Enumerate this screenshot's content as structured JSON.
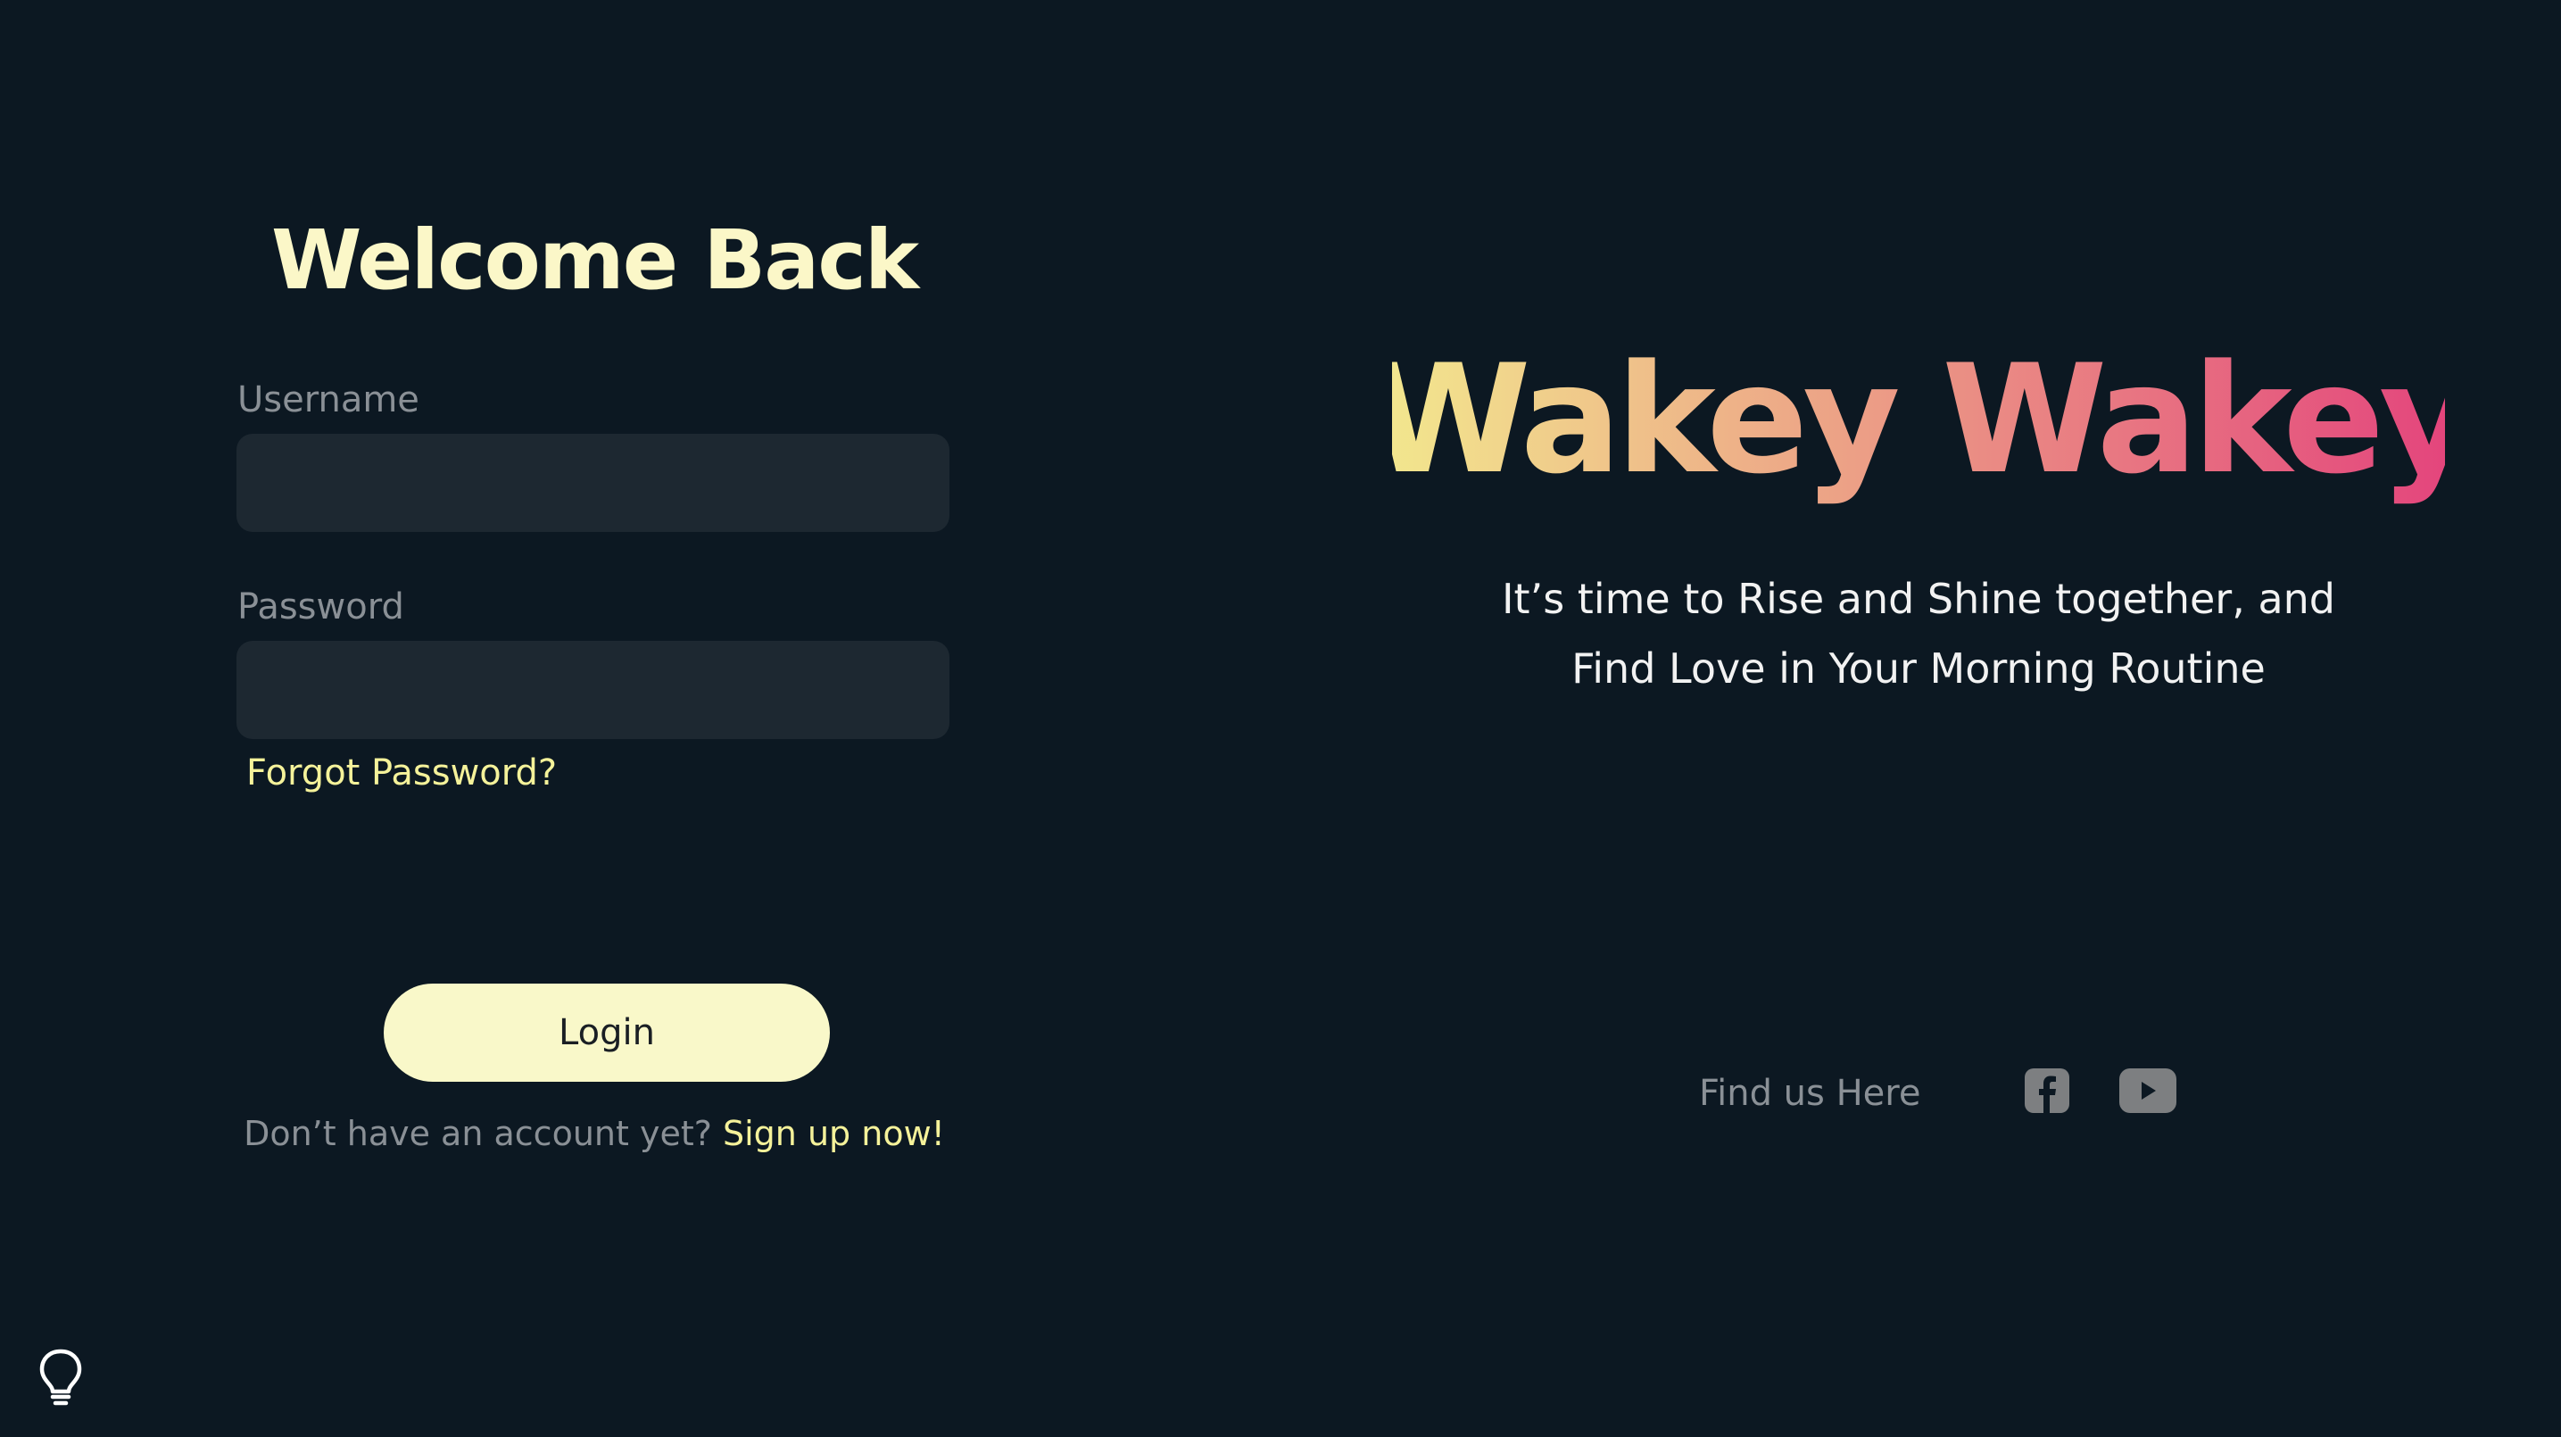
{
  "login": {
    "title": "Welcome Back",
    "username_label": "Username",
    "username_value": "",
    "password_label": "Password",
    "password_value": "",
    "forgot_password": "Forgot Password?",
    "login_button": "Login",
    "signup_prompt": "Don’t have an account yet?",
    "signup_link": "Sign up now!"
  },
  "brand": {
    "name": "Wakey Wakey",
    "gradient_start": "#f3ea8e",
    "gradient_end": "#e3417c",
    "tagline_line1": "It’s time to Rise and Shine together, and",
    "tagline_line2": "Find Love in Your Morning Routine"
  },
  "social": {
    "label": "Find us Here",
    "icons": [
      "facebook-icon",
      "youtube-icon"
    ]
  },
  "misc": {
    "theme_icon": "lightbulb-icon"
  },
  "colors": {
    "background": "#0c1822",
    "accent_yellow": "#f9f8c9",
    "input_bg": "#1d2831",
    "muted_text": "#8a9096"
  }
}
